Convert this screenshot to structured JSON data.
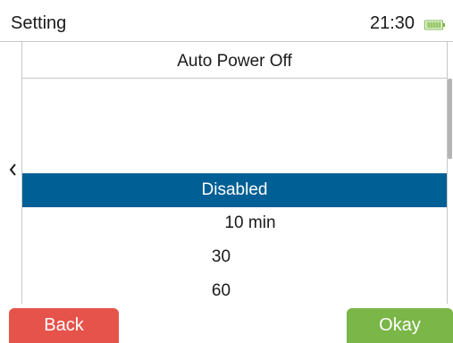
{
  "status_bar": {
    "title": "Setting",
    "time": "21:30",
    "battery_icon": "battery-icon"
  },
  "panel": {
    "title": "Auto Power Off"
  },
  "options": {
    "items": [
      "Disabled",
      "10 min",
      "30",
      "60"
    ],
    "selected": "Disabled"
  },
  "buttons": {
    "back_label": "Back",
    "okay_label": "Okay"
  },
  "icons": {
    "back": "chevron-left-icon"
  },
  "colors": {
    "selected_bg": "#005f94",
    "back_button": "#e5534b",
    "okay_button": "#7ab648",
    "battery": "#7ab648"
  }
}
